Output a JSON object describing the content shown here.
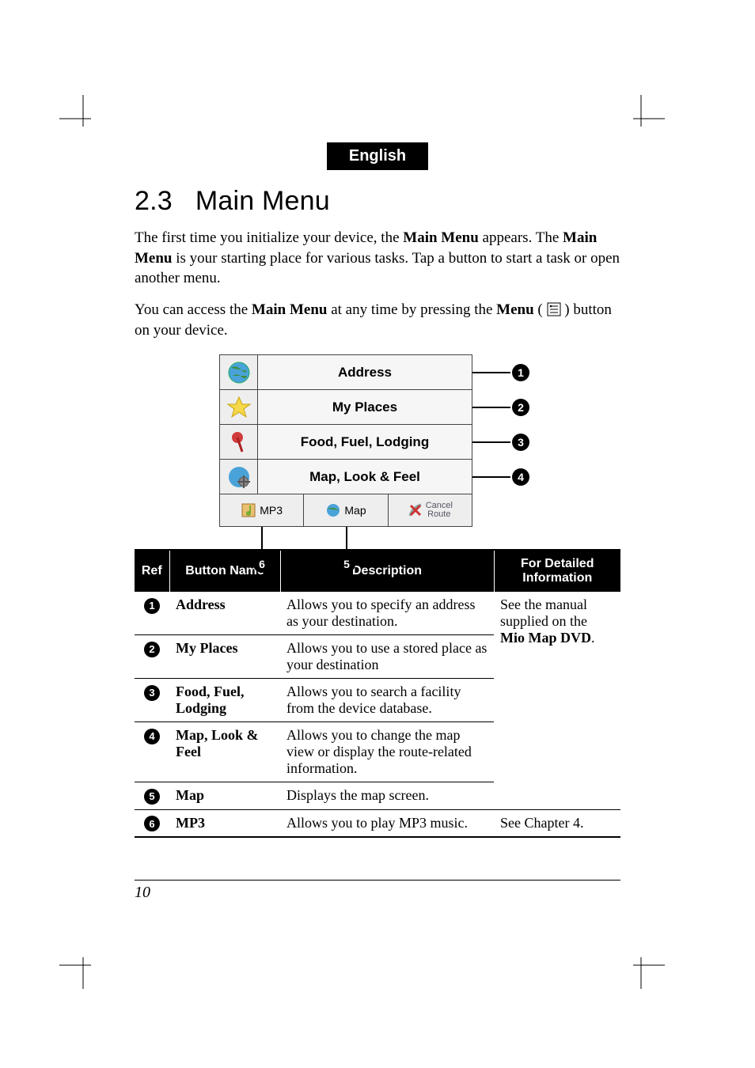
{
  "lang_pill": "English",
  "section_number": "2.3",
  "section_name": "Main Menu",
  "para1_parts": [
    "The first time you initialize your device, the ",
    "Main Menu",
    " appears. The ",
    "Main Menu",
    " is your starting place for various tasks. Tap a button to start a task or open another menu."
  ],
  "para2_parts": [
    "You can access the ",
    "Main Menu",
    " at any time by pressing the ",
    "Menu",
    " ( ",
    " ) button on your device."
  ],
  "menu": {
    "rows": [
      {
        "label": "Address"
      },
      {
        "label": "My Places"
      },
      {
        "label": "Food, Fuel, Lodging"
      },
      {
        "label": "Map, Look & Feel"
      }
    ],
    "bottom": {
      "mp3": "MP3",
      "map": "Map",
      "cancel_line1": "Cancel",
      "cancel_line2": "Route"
    }
  },
  "table": {
    "headers": {
      "ref": "Ref",
      "name": "Button Name",
      "desc": "Description",
      "info": "For Detailed Information"
    },
    "rows": [
      {
        "ref": "1",
        "name": "Address",
        "desc": "Allows you to specify an address as your destination."
      },
      {
        "ref": "2",
        "name": "My Places",
        "desc": "Allows you to use a stored place as your destination"
      },
      {
        "ref": "3",
        "name": "Food, Fuel, Lodging",
        "desc": "Allows you to search a facility from the device database."
      },
      {
        "ref": "4",
        "name": "Map, Look & Feel",
        "desc": "Allows you to change the map view or display the route-related information."
      },
      {
        "ref": "5",
        "name": "Map",
        "desc": "Displays the map screen."
      },
      {
        "ref": "6",
        "name": "MP3",
        "desc": "Allows you to play MP3 music.",
        "info": "See Chapter 4."
      }
    ],
    "info_merged_parts": [
      "See the manual supplied on the ",
      "Mio Map DVD",
      "."
    ]
  },
  "page_number": "10"
}
